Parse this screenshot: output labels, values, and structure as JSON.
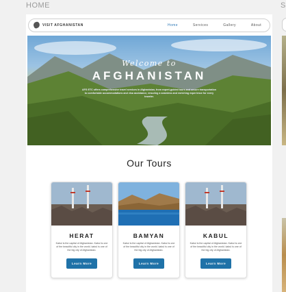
{
  "frame": {
    "label": "HOME",
    "next_label": "S"
  },
  "navbar": {
    "brand": "VISIT AFGHANISTAN",
    "links": [
      {
        "label": "Home",
        "active": true
      },
      {
        "label": "Services",
        "active": false
      },
      {
        "label": "Gallery",
        "active": false
      },
      {
        "label": "About",
        "active": false
      }
    ]
  },
  "hero": {
    "welcome": "Welcome to",
    "title": "AFGHANISTAN",
    "description": "AFG ETC offers comprehensive travel services in Afghanistan, from expert-guided tours and secure transportation to comfortable accommodations and visa assistance, ensuring a seamless and enriching experience for every traveler."
  },
  "tours": {
    "title": "Our Tours",
    "cards": [
      {
        "name": "HERAT",
        "description": "Kabul is the capital of Afghanistan. Kabul is one of the beautiful city in the world. kabul is one of the big city of Afghanistan.",
        "button": "Learn More"
      },
      {
        "name": "BAMYAN",
        "description": "Kabul is the capital of Afghanistan. Kabul is one of the beautiful city in the world. kabul is one of the big city of Afghanistan.",
        "button": "Learn More"
      },
      {
        "name": "KABUL",
        "description": "Kabul is the capital of Afghanistan. Kabul is one of the beautiful city in the world. kabul is one of the big city of Afghanistan.",
        "button": "Learn More"
      }
    ]
  },
  "colors": {
    "accent": "#2f79b7",
    "button": "#1f72a8"
  }
}
